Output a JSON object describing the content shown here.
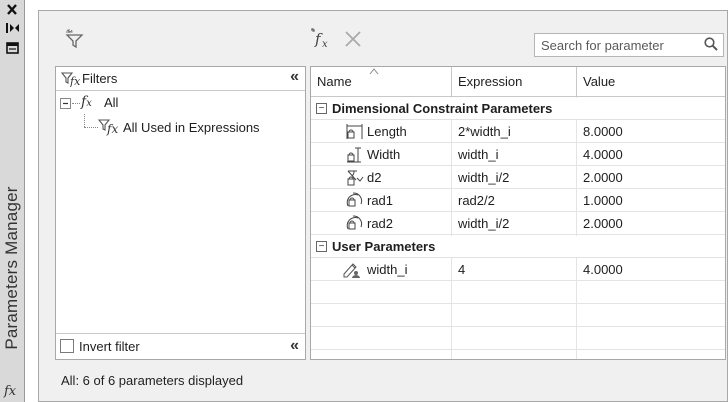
{
  "sidestrip": {
    "close_icon": "close-icon",
    "autohide_icon": "autohide-icon",
    "properties_icon": "properties-icon",
    "title": "Parameters Manager",
    "fx_label": "fx"
  },
  "toolbar": {
    "new_filter_icon": "filter-star-icon",
    "new_parameter_icon": "fx-star-icon",
    "delete_icon": "delete-icon",
    "search_placeholder": "Search for parameter",
    "search_icon": "magnifier-icon"
  },
  "filters": {
    "header": "Filters",
    "collapse_label": "«",
    "tree": [
      {
        "label": "All",
        "expanded": true
      },
      {
        "label": "All Used in Expressions"
      }
    ],
    "invert_label": "Invert filter",
    "invert_checked": false
  },
  "grid": {
    "columns": [
      "Name",
      "Expression",
      "Value"
    ],
    "groups": [
      {
        "label": "Dimensional Constraint Parameters",
        "rows": [
          {
            "icon": "linear-dimension-icon",
            "name": "Length",
            "expression": "2*width_i",
            "value": "8.0000"
          },
          {
            "icon": "vertical-dimension-icon",
            "name": "Width",
            "expression": "width_i",
            "value": "4.0000"
          },
          {
            "icon": "angular-dimension-icon",
            "name": "d2",
            "expression": "width_i/2",
            "value": "2.0000"
          },
          {
            "icon": "radial-dimension-icon",
            "name": "rad1",
            "expression": "rad2/2",
            "value": "1.0000"
          },
          {
            "icon": "radial-dimension-icon",
            "name": "rad2",
            "expression": "width_i/2",
            "value": "2.0000"
          }
        ]
      },
      {
        "label": "User Parameters",
        "rows": [
          {
            "icon": "user-parameter-icon",
            "name": "width_i",
            "expression": "4",
            "value": "4.0000"
          }
        ]
      }
    ],
    "group_toggle": "−"
  },
  "status": "All: 6 of 6 parameters displayed"
}
